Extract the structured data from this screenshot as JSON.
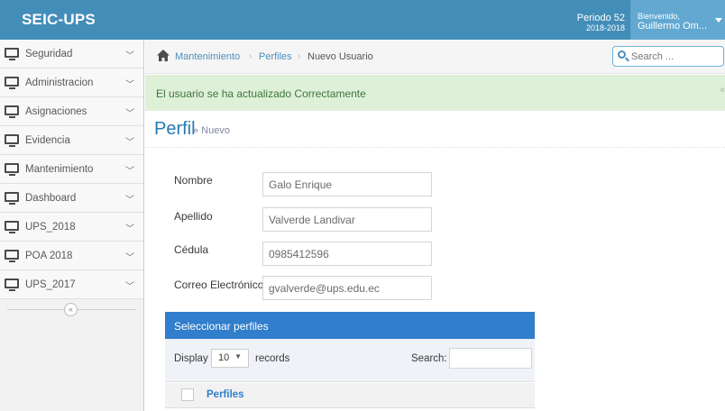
{
  "app": {
    "brand": "SEIC-UPS",
    "periodo_label": "Periodo 52",
    "periodo_years": "2018-2018",
    "welcome_label": "Bienvenido,",
    "user_name": "Guillermo Om..."
  },
  "sidebar": {
    "items": [
      {
        "label": "Seguridad"
      },
      {
        "label": "Administracion"
      },
      {
        "label": "Asignaciones"
      },
      {
        "label": "Evidencia"
      },
      {
        "label": "Mantenimiento"
      },
      {
        "label": "Dashboard"
      },
      {
        "label": "UPS_2018"
      },
      {
        "label": "POA 2018"
      },
      {
        "label": "UPS_2017"
      }
    ],
    "collapse_glyph": "«"
  },
  "breadcrumb": {
    "items": [
      "Mantenimiento",
      "Perfiles",
      "Nuevo Usuario"
    ],
    "separator": "›"
  },
  "search": {
    "placeholder": "Search ..."
  },
  "alert": {
    "message": "El usuario se ha actualizado Correctamente",
    "close": "×"
  },
  "page": {
    "title": "Perfil",
    "subtitle": "» Nuevo"
  },
  "form": {
    "fields": [
      {
        "label": "Nombre",
        "value": "Galo Enrique"
      },
      {
        "label": "Apellido",
        "value": "Valverde Landivar"
      },
      {
        "label": "Cédula",
        "value": "0985412596"
      },
      {
        "label": "Correo Electrónico",
        "value": "gvalverde@ups.edu.ec"
      }
    ]
  },
  "profiles_widget": {
    "title": "Seleccionar perfiles",
    "display_label": "Display",
    "page_size": "10",
    "records_label": "records",
    "search_label": "Search:",
    "column_header": "Perfiles"
  },
  "colors": {
    "navbar": "#438eb9",
    "accent": "#307ecc",
    "link": "#4c8fbd",
    "success_bg": "#dff0d8",
    "success_text": "#3c763d"
  }
}
